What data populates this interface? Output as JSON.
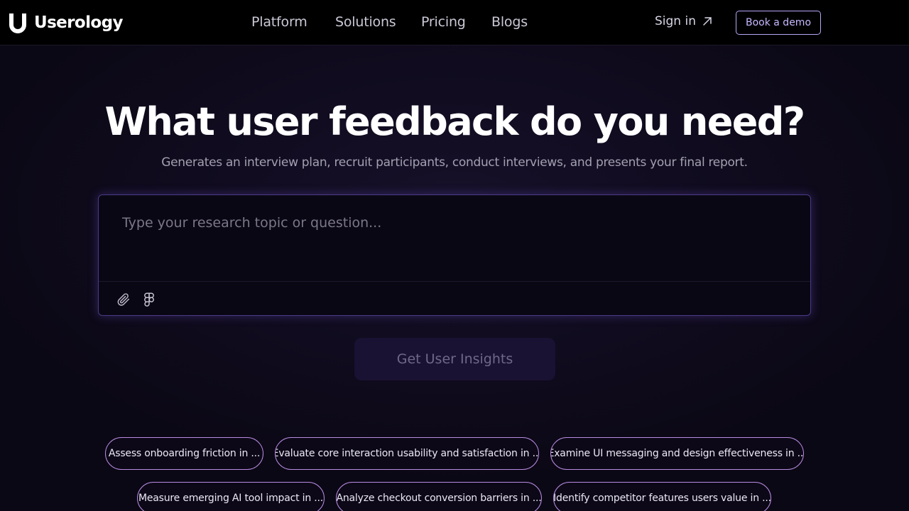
{
  "brand": {
    "name": "Userology"
  },
  "nav": {
    "links": [
      "Platform",
      "Solutions",
      "Pricing",
      "Blogs"
    ],
    "sign_in": "Sign in",
    "book_demo": "Book a demo"
  },
  "hero": {
    "title": "What user feedback do you need?",
    "subtitle": "Generates an interview plan, recruit participants, conduct interviews, and presents your final report."
  },
  "input": {
    "placeholder": "Type your research topic or question...",
    "value": ""
  },
  "cta": {
    "label": "Get User Insights"
  },
  "chips": [
    "Assess onboarding friction in ...",
    "Evaluate core interaction usability and satisfaction in ...",
    "Examine UI messaging and design effectiveness in ...",
    "Measure emerging AI tool impact in ...",
    "Analyze checkout conversion barriers in ...",
    "Identify competitor features users value in ..."
  ],
  "icons": {
    "logo": "userology-logo-icon",
    "sign_in": "arrow-up-right-icon",
    "attach": "paperclip-icon",
    "figma": "figma-icon"
  },
  "colors": {
    "background": "#0c0817",
    "accent": "#b7a6f6",
    "chip_border": "#b98be2",
    "cta_bg": "#1a1233"
  }
}
